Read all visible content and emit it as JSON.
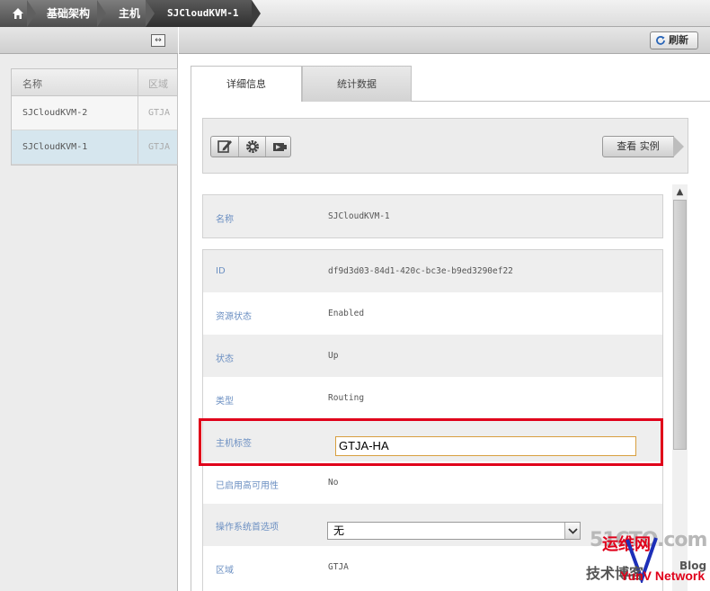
{
  "breadcrumb": {
    "home_icon": "home-icon",
    "items": [
      "基础架构",
      "主机",
      "SJCloudKVM-1"
    ]
  },
  "left": {
    "expand_icon": "expand-horizontal-icon",
    "columns": [
      "名称",
      "区域"
    ],
    "rows": [
      {
        "name": "SJCloudKVM-2",
        "zone": "GTJA"
      },
      {
        "name": "SJCloudKVM-1",
        "zone": "GTJA"
      }
    ]
  },
  "toolbar": {
    "refresh_label": "刷新"
  },
  "tabs": [
    "详细信息",
    "统计数据"
  ],
  "actions": {
    "icons": [
      "edit-icon",
      "gear-icon",
      "maintenance-icon"
    ],
    "view_instances_label": "查看 实例"
  },
  "details": {
    "name": {
      "label": "名称",
      "value": "SJCloudKVM-1"
    },
    "rows": [
      {
        "label": "ID",
        "value": "df9d3d03-84d1-420c-bc3e-b9ed3290ef22"
      },
      {
        "label": "资源状态",
        "value": "Enabled"
      },
      {
        "label": "状态",
        "value": "Up"
      },
      {
        "label": "类型",
        "value": "Routing"
      },
      {
        "label": "主机标签",
        "value": "GTJA-HA"
      },
      {
        "label": "已启用高可用性",
        "value": "No"
      },
      {
        "label": "操作系统首选项",
        "value": "无"
      },
      {
        "label": "区域",
        "value": "GTJA"
      }
    ]
  },
  "watermark": {
    "top": "51CTO.com",
    "red": "运维网",
    "bottom": "技术博客",
    "blog": "Blog",
    "net": "YunV Network"
  },
  "colors": {
    "label_blue": "#6b8fc2",
    "highlight_red": "#e0001a",
    "input_border": "#d89f3f"
  }
}
